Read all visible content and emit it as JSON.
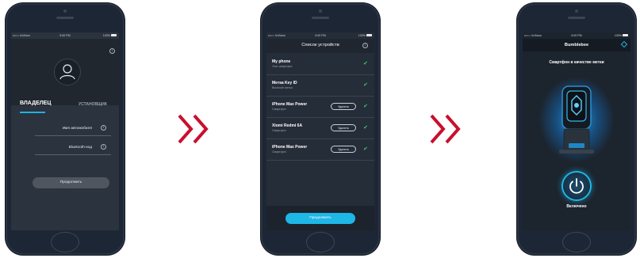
{
  "status_bar": {
    "carrier": "•••○○ InVision",
    "time": "9:00 PM",
    "battery": "100%"
  },
  "colors": {
    "accent": "#1eb7e6",
    "arrow": "#c8102e",
    "check": "#38c76b"
  },
  "screen1": {
    "tabs": [
      {
        "label": "ВЛАДЕЛЕЦ",
        "active": true
      },
      {
        "label": "УСТАНОВЩИК",
        "active": false
      }
    ],
    "fields": [
      {
        "label": "Имя автомобиля"
      },
      {
        "label": "Bluetooth-код"
      }
    ],
    "continue_label": "Продолжить",
    "info_icon": "info-icon",
    "avatar_icon": "user-icon"
  },
  "screen2": {
    "title": "Список устройств",
    "devices": [
      {
        "name": "My phone",
        "type": "Этот смартфон",
        "delete": null
      },
      {
        "name": "Метка Key ID",
        "type": "Bluetooth метка",
        "delete": null
      },
      {
        "name": "iPhone Max Power",
        "type": "Смартфон",
        "delete": "Удалить"
      },
      {
        "name": "Xiomi Redmi 6A",
        "type": "Смартфон",
        "delete": "Удалить"
      },
      {
        "name": "iPhone Max Power",
        "type": "Смартфон",
        "delete": "Удалить"
      }
    ],
    "continue_label": "Продолжить"
  },
  "screen3": {
    "title": "Bumblebee",
    "caption": "Смартфон в качестве метки",
    "state_label": "Включено",
    "power_icon": "power-icon"
  }
}
